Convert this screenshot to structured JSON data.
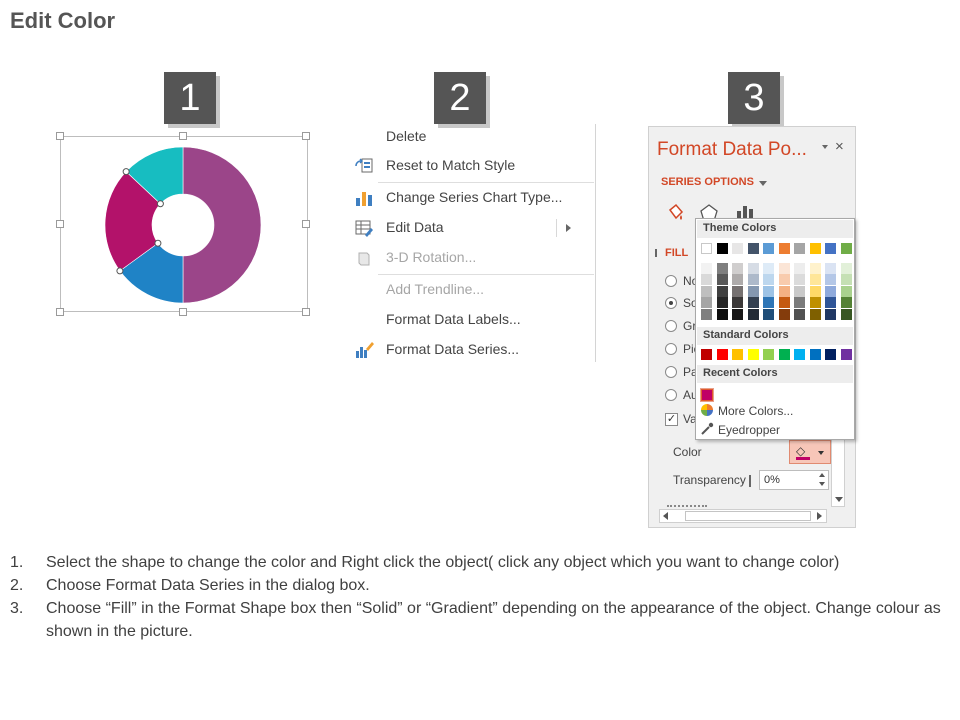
{
  "page": {
    "title": "Edit Color"
  },
  "steps": [
    {
      "number": "1"
    },
    {
      "number": "2"
    },
    {
      "number": "3"
    }
  ],
  "chart": {
    "segments": [
      {
        "name": "purple",
        "value": 50,
        "color": "#9b4589"
      },
      {
        "name": "blue",
        "value": 15,
        "color": "#1f83c6"
      },
      {
        "name": "magenta",
        "value": 22,
        "color": "#b3126a"
      },
      {
        "name": "teal",
        "value": 13,
        "color": "#17bdc1"
      }
    ]
  },
  "context_menu": {
    "items": [
      {
        "label": "Delete",
        "icon": "none"
      },
      {
        "label": "Reset to Match Style",
        "icon": "reset-style-icon"
      },
      {
        "label": "Change Series Chart Type...",
        "icon": "chart-type-icon"
      },
      {
        "label": "Edit Data",
        "icon": "edit-data-icon"
      },
      {
        "label": "3-D Rotation...",
        "icon": "rotation-icon"
      },
      {
        "label": "Add Trendline...",
        "icon": "none"
      },
      {
        "label": "Format Data Labels...",
        "icon": "none"
      },
      {
        "label": "Format Data Series...",
        "icon": "format-series-icon"
      }
    ]
  },
  "format_pane": {
    "title": "Format Data Po...",
    "close": "×",
    "series_options": "SERIES OPTIONS",
    "fill_section": "FILL",
    "fill_options": [
      "No",
      "So",
      "Gr",
      "Pic",
      "Pa",
      "Au"
    ],
    "vary_label": "Va",
    "vary_check": "✓",
    "color_label": "Color",
    "transparency_label": "Transparency",
    "transparency_value": "0%",
    "selected_color": "#c00066"
  },
  "color_popup": {
    "theme_header": "Theme Colors",
    "standard_header": "Standard Colors",
    "recent_header": "Recent Colors",
    "more_colors": "More Colors...",
    "eyedropper": "Eyedropper",
    "theme_columns": [
      [
        "#ffffff",
        "#f2f2f2",
        "#d9d9d9",
        "#bfbfbf",
        "#a6a6a6",
        "#7f7f7f"
      ],
      [
        "#000000",
        "#7f7f7f",
        "#595959",
        "#404040",
        "#262626",
        "#0d0d0d"
      ],
      [
        "#e7e6e6",
        "#d0cece",
        "#aeabab",
        "#767171",
        "#3b3838",
        "#181717"
      ],
      [
        "#44546a",
        "#d6dce5",
        "#adb9ca",
        "#8497b0",
        "#333f50",
        "#222a35"
      ],
      [
        "#5b9bd5",
        "#deebf7",
        "#bdd7ee",
        "#9dc3e6",
        "#2e75b6",
        "#1f4e79"
      ],
      [
        "#ed7d31",
        "#fbe5d6",
        "#f8cbad",
        "#f4b183",
        "#c55a11",
        "#843c0c"
      ],
      [
        "#a5a5a5",
        "#ededed",
        "#dbdbdb",
        "#c9c9c9",
        "#7b7b7b",
        "#525252"
      ],
      [
        "#ffc000",
        "#fff2cc",
        "#ffe699",
        "#ffd966",
        "#bf9000",
        "#7f6000"
      ],
      [
        "#4472c4",
        "#dae3f3",
        "#b4c7e7",
        "#8faadc",
        "#2f5597",
        "#203864"
      ],
      [
        "#70ad47",
        "#e2f0d9",
        "#c5e0b4",
        "#a9d18e",
        "#548235",
        "#385723"
      ]
    ],
    "standard_colors": [
      "#c00000",
      "#ff0000",
      "#ffc000",
      "#ffff00",
      "#92d050",
      "#00b050",
      "#00b0f0",
      "#0070c0",
      "#002060",
      "#7030a0"
    ],
    "recent_colors": [
      "#c00066"
    ]
  },
  "instructions": [
    {
      "number": "1.",
      "text": "Select the shape to change the color and Right click the object( click any object which you want to change color)"
    },
    {
      "number": "2.",
      "text": "Choose Format Data Series in the dialog box."
    },
    {
      "number": "3.",
      "text": "Choose “Fill” in the Format Shape box then “Solid” or “Gradient” depending on the appearance of the object. Change colour as shown in the picture."
    }
  ]
}
